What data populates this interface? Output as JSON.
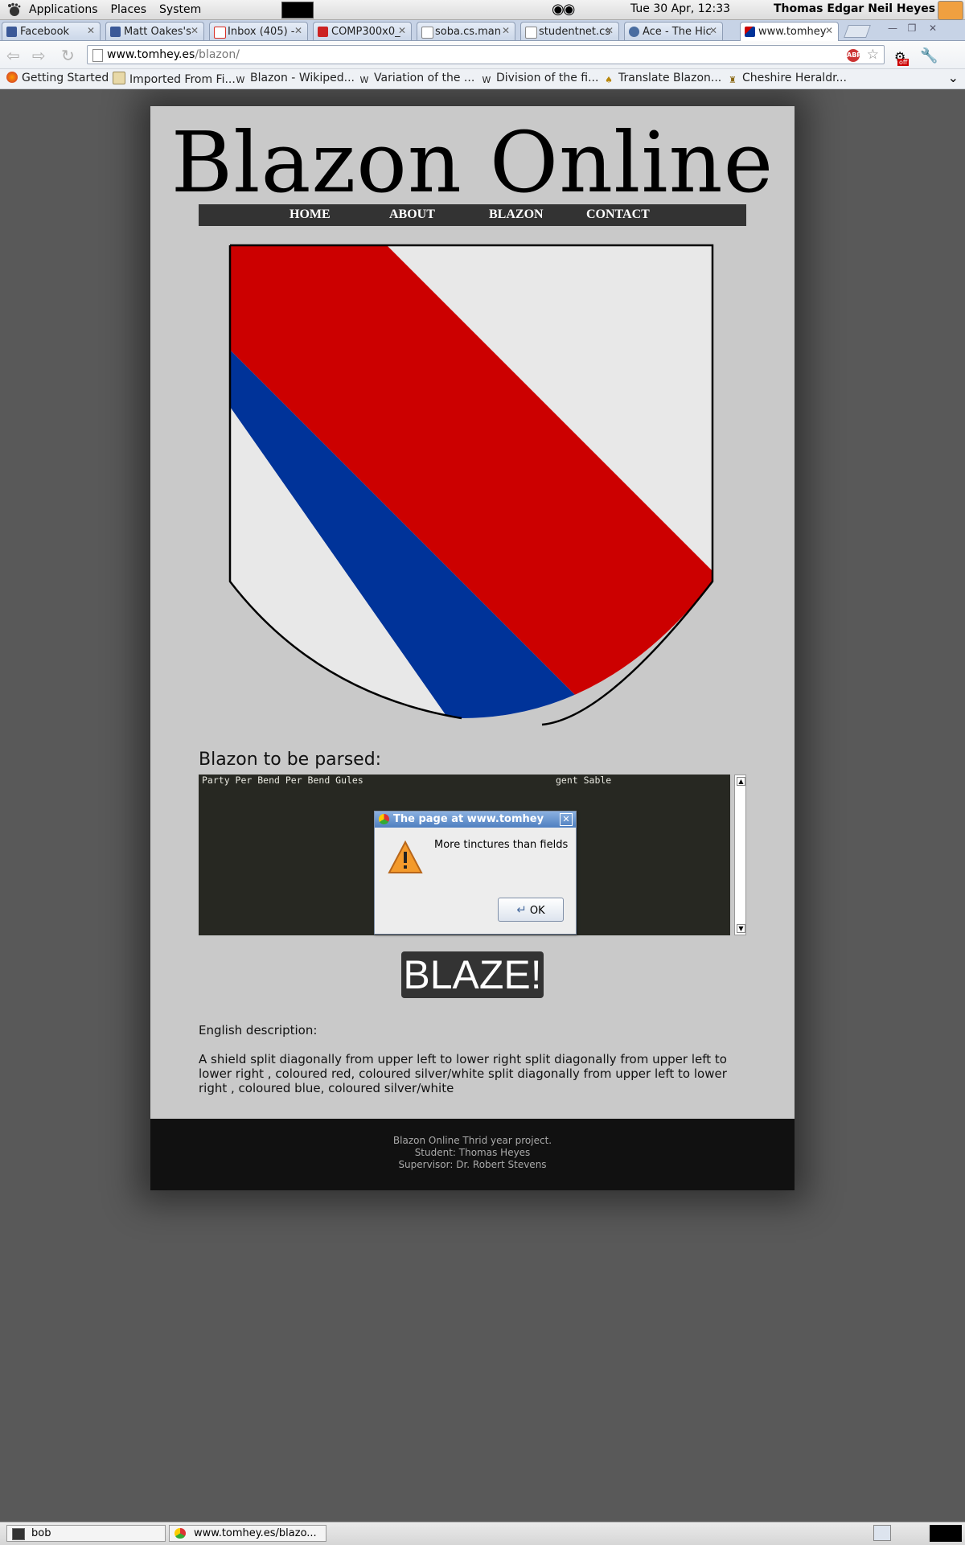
{
  "panel": {
    "menus": [
      "Applications",
      "Places",
      "System"
    ],
    "clock": "Tue 30 Apr, 12:33",
    "user": "Thomas Edgar Neil Heyes"
  },
  "tabs": [
    {
      "label": "Facebook",
      "favicon_color": "#3b5998"
    },
    {
      "label": "Matt Oakes's",
      "favicon_color": "#3b5998"
    },
    {
      "label": "Inbox (405) -",
      "favicon_color": "#d93025"
    },
    {
      "label": "COMP300x0_",
      "favicon_color": "#cc2222"
    },
    {
      "label": "soba.cs.man",
      "favicon_color": "#ffffff"
    },
    {
      "label": "studentnet.cs",
      "favicon_color": "#ffffff"
    },
    {
      "label": "Ace - The Hic",
      "favicon_color": "#4a6da0"
    },
    {
      "label": "www.tomhey",
      "favicon_color": "#0033a0"
    }
  ],
  "toolbar": {
    "url_domain": "www.tomhey.es",
    "url_path": "/blazon/",
    "ext_badge": "off"
  },
  "bookmarks": [
    {
      "label": "Getting Started",
      "icon": "firefox-icon"
    },
    {
      "label": "Imported From Fi...",
      "icon": "folder-icon"
    },
    {
      "label": "Blazon - Wikiped...",
      "icon": "wikipedia-icon"
    },
    {
      "label": "Variation of the ...",
      "icon": "wikipedia-icon"
    },
    {
      "label": "Division of the fi...",
      "icon": "wikipedia-icon"
    },
    {
      "label": "Translate Blazon...",
      "icon": "lion-icon"
    },
    {
      "label": "Cheshire Heraldr...",
      "icon": "chess-icon"
    }
  ],
  "site": {
    "logo": "Blazon Online",
    "nav": [
      "HOME",
      "ABOUT",
      "BLAZON",
      "CONTACT"
    ],
    "shield_colors": {
      "field": "#e8e8e8",
      "red_band": "#cc0000",
      "blue_band": "#003399",
      "outline": "#000000"
    },
    "blazon_heading": "Blazon to be parsed:",
    "editor_text_left": "Party Per Bend Per Bend Gules",
    "editor_text_right": "gent Sable",
    "blaze_button": "BLAZE!",
    "english_label": "English description:",
    "english_text": "A shield split diagonally from upper left to lower right split diagonally from upper left to lower right , coloured red, coloured silver/white split diagonally from upper left to lower right , coloured blue, coloured silver/white",
    "footer": [
      "Blazon Online Thrid year project.",
      "Student: Thomas Heyes",
      "Supervisor: Dr. Robert Stevens"
    ]
  },
  "alert": {
    "title": "The page at www.tomhey",
    "message": "More tinctures than fields",
    "ok": "OK"
  },
  "taskbar": [
    {
      "label": "bob",
      "icon": "terminal-icon"
    },
    {
      "label": "www.tomhey.es/blazo...",
      "icon": "chrome-icon"
    }
  ]
}
